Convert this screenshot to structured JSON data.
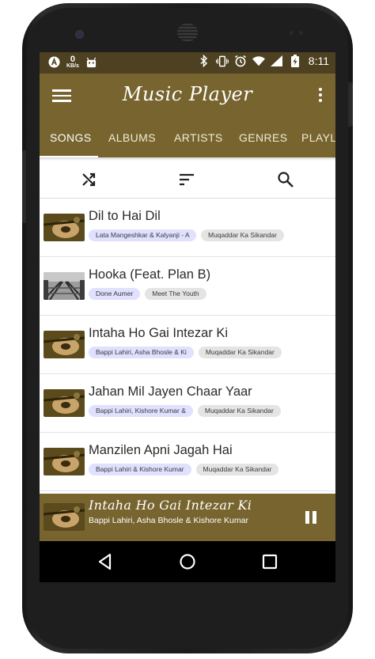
{
  "status_bar": {
    "net_speed_value": "0",
    "net_speed_unit": "KB/s",
    "time": "8:11"
  },
  "app_bar": {
    "title": "Music Player",
    "menu_icon": "hamburger-menu-icon",
    "more_icon": "more-vertical-icon"
  },
  "tabs": [
    {
      "label": "SONGS",
      "active": true
    },
    {
      "label": "ALBUMS",
      "active": false
    },
    {
      "label": "ARTISTS",
      "active": false
    },
    {
      "label": "GENRES",
      "active": false
    },
    {
      "label": "PLAYLISTS",
      "active": false
    }
  ],
  "toolbar": {
    "shuffle_icon": "shuffle-icon",
    "sort_icon": "sort-icon",
    "search_icon": "search-icon"
  },
  "songs": [
    {
      "title": "Dil to Hai Dil",
      "artist": "Lata Mangeshkar & Kalyanji - A",
      "album": "Muqaddar Ka Sikandar",
      "art": "mandolin"
    },
    {
      "title": "Hooka (Feat. Plan B)",
      "artist": "Done Aumer",
      "album": "Meet The Youth",
      "art": "rails"
    },
    {
      "title": "Intaha Ho Gai Intezar Ki",
      "artist": "Bappi Lahiri, Asha Bhosle & Ki",
      "album": "Muqaddar Ka Sikandar",
      "art": "mandolin"
    },
    {
      "title": "Jahan Mil Jayen Chaar Yaar",
      "artist": "Bappi Lahiri, Kishore Kumar &",
      "album": "Muqaddar Ka Sikandar",
      "art": "mandolin"
    },
    {
      "title": "Manzilen Apni Jagah Hai",
      "artist": "Bappi Lahiri & Kishore Kumar",
      "album": "Muqaddar Ka Sikandar",
      "art": "mandolin"
    }
  ],
  "now_playing": {
    "title": "Intaha Ho Gai Intezar Ki",
    "artist": "Bappi Lahiri, Asha Bhosle & Kishore Kumar",
    "control_icon": "pause-icon"
  },
  "nav_bar": {
    "back_icon": "back-triangle-icon",
    "home_icon": "home-circle-icon",
    "recents_icon": "recents-square-icon"
  },
  "colors": {
    "primary": "#77642f",
    "status_bar": "#4e4121",
    "artist_chip": "#e0e0ff",
    "album_chip": "#e4e4e4"
  }
}
